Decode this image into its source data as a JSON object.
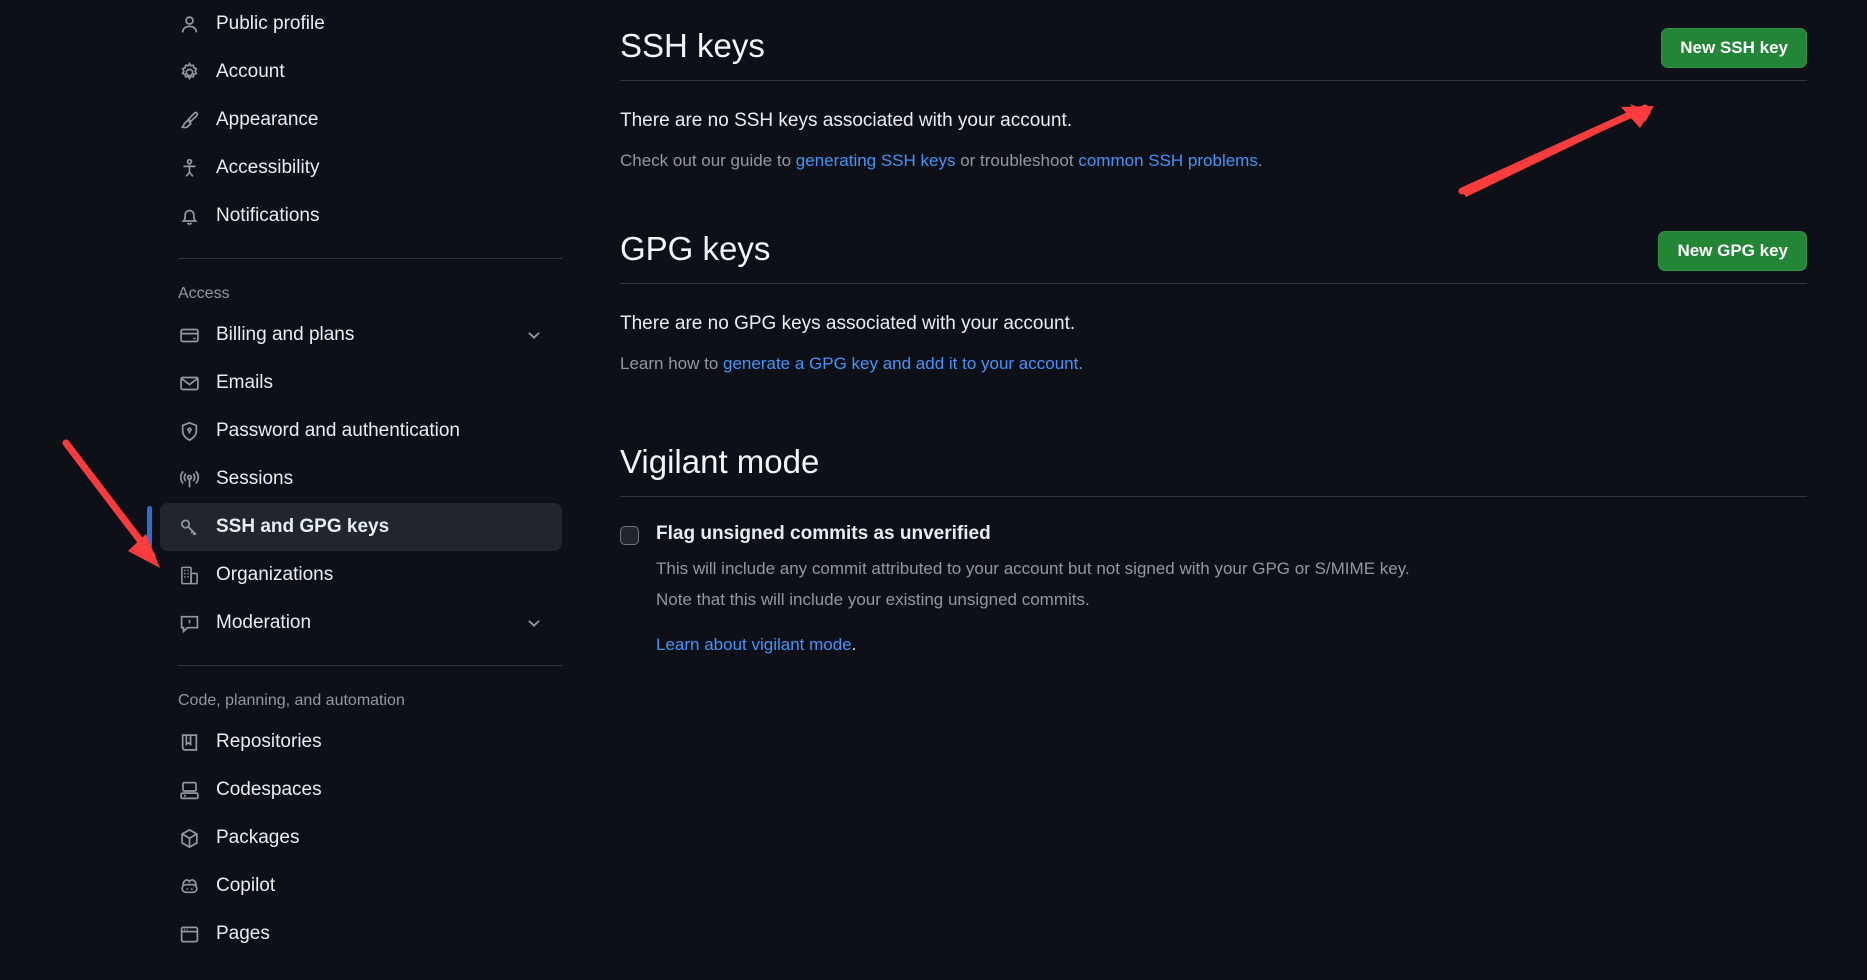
{
  "sidebar": {
    "groups": [
      {
        "title": null,
        "items": [
          {
            "label": "Public profile",
            "icon": "person-icon",
            "chevron": false,
            "selected": false
          },
          {
            "label": "Account",
            "icon": "gear-icon",
            "chevron": false,
            "selected": false
          },
          {
            "label": "Appearance",
            "icon": "paintbrush-icon",
            "chevron": false,
            "selected": false
          },
          {
            "label": "Accessibility",
            "icon": "accessibility-icon",
            "chevron": false,
            "selected": false
          },
          {
            "label": "Notifications",
            "icon": "bell-icon",
            "chevron": false,
            "selected": false
          }
        ]
      },
      {
        "title": "Access",
        "items": [
          {
            "label": "Billing and plans",
            "icon": "credit-card-icon",
            "chevron": true,
            "selected": false
          },
          {
            "label": "Emails",
            "icon": "mail-icon",
            "chevron": false,
            "selected": false
          },
          {
            "label": "Password and authentication",
            "icon": "shield-lock-icon",
            "chevron": false,
            "selected": false
          },
          {
            "label": "Sessions",
            "icon": "broadcast-icon",
            "chevron": false,
            "selected": false
          },
          {
            "label": "SSH and GPG keys",
            "icon": "key-icon",
            "chevron": false,
            "selected": true
          },
          {
            "label": "Organizations",
            "icon": "organization-icon",
            "chevron": false,
            "selected": false
          },
          {
            "label": "Moderation",
            "icon": "report-icon",
            "chevron": true,
            "selected": false
          }
        ]
      },
      {
        "title": "Code, planning, and automation",
        "items": [
          {
            "label": "Repositories",
            "icon": "repo-icon",
            "chevron": false,
            "selected": false
          },
          {
            "label": "Codespaces",
            "icon": "codespaces-icon",
            "chevron": false,
            "selected": false
          },
          {
            "label": "Packages",
            "icon": "package-icon",
            "chevron": false,
            "selected": false
          },
          {
            "label": "Copilot",
            "icon": "copilot-icon",
            "chevron": false,
            "selected": false
          },
          {
            "label": "Pages",
            "icon": "browser-icon",
            "chevron": false,
            "selected": false
          }
        ]
      }
    ]
  },
  "main": {
    "ssh": {
      "title": "SSH keys",
      "button": "New SSH key",
      "empty_text": "There are no SSH keys associated with your account.",
      "help_prefix": "Check out our guide to ",
      "help_link1": "generating SSH keys",
      "help_middle": " or troubleshoot ",
      "help_link2": "common SSH problems",
      "help_suffix": "."
    },
    "gpg": {
      "title": "GPG keys",
      "button": "New GPG key",
      "empty_text": "There are no GPG keys associated with your account.",
      "help_prefix": "Learn how to ",
      "help_link": "generate a GPG key and add it to your account",
      "help_suffix": "."
    },
    "vigilant": {
      "title": "Vigilant mode",
      "checkbox_label": "Flag unsigned commits as unverified",
      "desc_line1": "This will include any commit attributed to your account but not signed with your GPG or S/MIME key.",
      "desc_line2": "Note that this will include your existing unsigned commits.",
      "learn_link": "Learn about vigilant mode",
      "learn_suffix": "."
    }
  },
  "colors": {
    "background": "#0d1117",
    "accent_green": "#238636",
    "link_blue": "#4493f8",
    "selected_indicator": "#316dca",
    "annotation_red": "#fa3c3c",
    "selected_bg": "#21262d",
    "muted_text": "#9198a1"
  },
  "annotations": {
    "arrow_to_new_ssh_key": "red-arrow-pointing-to-new-ssh-key-button",
    "arrow_to_ssh_gpg_nav": "red-arrow-pointing-to-ssh-and-gpg-keys-nav-item"
  }
}
